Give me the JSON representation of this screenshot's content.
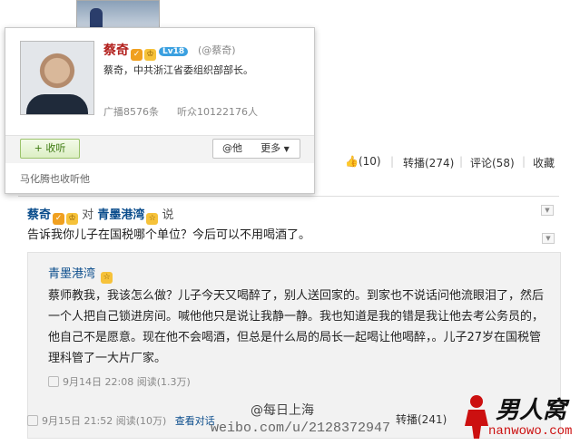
{
  "profile_card": {
    "name": "蔡奇",
    "level_badge": "Lv18",
    "handle": "(@蔡奇)",
    "description": "蔡奇，中共浙江省委组织部部长。",
    "posts": "广播8576条",
    "listeners": "听众10122176人",
    "follow_label": "+ 收听",
    "at_label": "@他",
    "more_label": "更多",
    "mutual_text": "马化腾也收听他"
  },
  "post_actions": {
    "likes": "(10)",
    "repost": "转播(274)",
    "comment": "评论(58)",
    "favorite": "收藏"
  },
  "comment": {
    "author": "蔡奇",
    "dui": "对",
    "target": "青墨港湾",
    "say": "说",
    "text": "告诉我你儿子在国税哪个单位？今后可以不用喝酒了。"
  },
  "quoted": {
    "author": "青墨港湾",
    "text": "蔡师教我，我该怎么做？儿子今天又喝醉了，别人送回家的。到家也不说话问他流眼泪了，然后一个人把自己锁进房间。喊他他只是说让我静一静。我也知道是我的错是我让他去考公务员的，他自己不是愿意。现在他不会喝酒，但总是什么局的局长一起喝让他喝醉，。儿子27岁在国税管理科管了一大片厂家。",
    "meta": "9月14日 22:08 阅读(1.3万)"
  },
  "bottom": {
    "meta_time": "9月15日 21:52 阅读(10万)",
    "view_dialog": "查看对话",
    "repost": "转播(241)",
    "watermark_daily": "@每日上海",
    "watermark_url": "weibo.com/u/2128372947",
    "logo_text": "男人窝",
    "logo_url": "nanwowo.com"
  },
  "colors": {
    "link_blue": "#0b4d8c",
    "name_red": "#b3211e",
    "follow_green": "#3d7a11"
  }
}
